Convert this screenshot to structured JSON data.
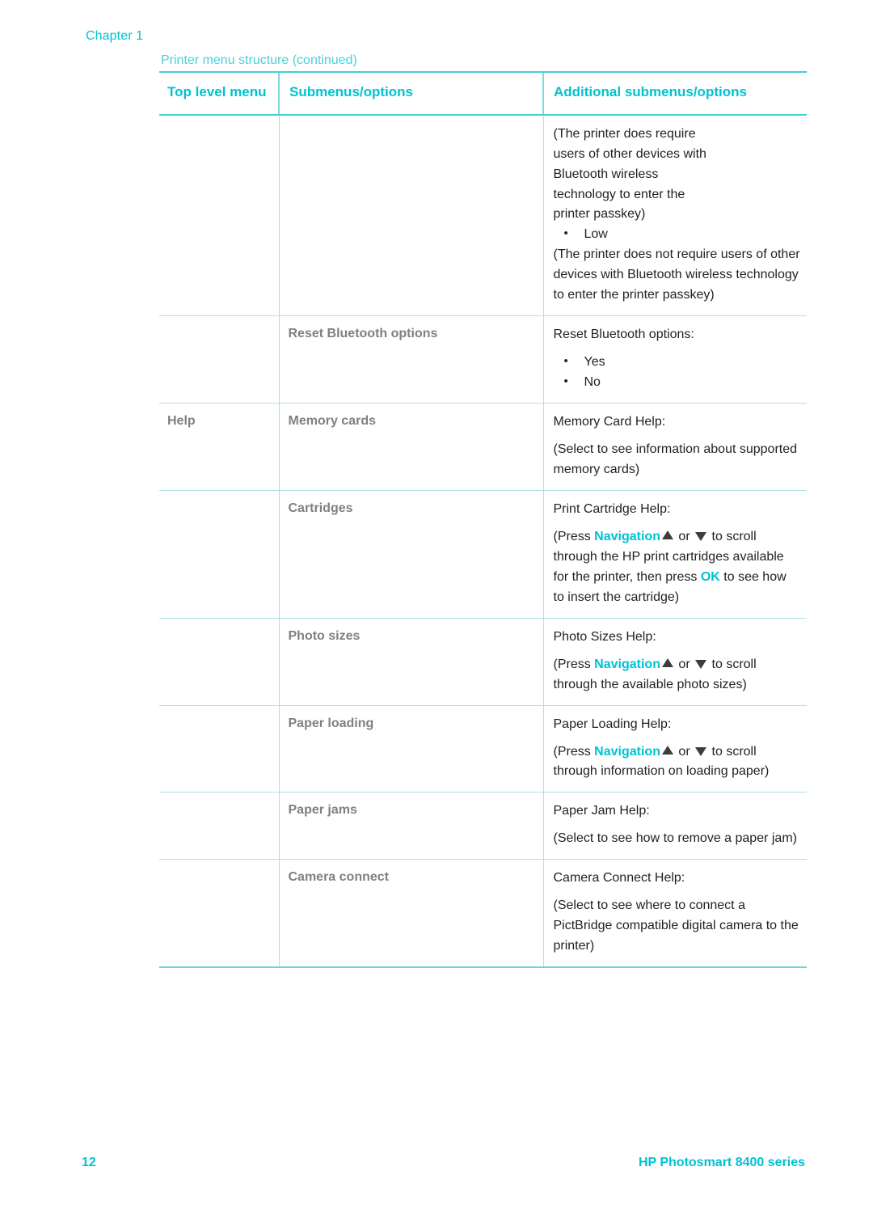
{
  "document": {
    "chapter_label": "Chapter 1",
    "table_caption": "Printer menu structure (continued)"
  },
  "colors": {
    "accent_cyan": "#00c2d1",
    "caption_cyan": "#4ecfd8",
    "label_gray": "#808080",
    "body_text": "#231f20",
    "rule_light": "#a9e2e8",
    "rule_strong": "#3fcfd8"
  },
  "table": {
    "headers": {
      "col1": "Top level menu",
      "col2": "Submenus/options",
      "col3": "Additional submenus/options"
    },
    "rows": [
      {
        "top_level": "",
        "submenu": "",
        "additional": {
          "continuation_lines": [
            "(The printer does require",
            "users of other devices with",
            "Bluetooth wireless",
            "technology to enter the",
            "printer passkey)"
          ],
          "bullets": [
            {
              "label": "Low",
              "note": "(The printer does not require users of other devices with Bluetooth wireless technology to enter the printer passkey)"
            }
          ]
        }
      },
      {
        "top_level": "",
        "submenu": "Reset Bluetooth options",
        "additional": {
          "heading": "Reset Bluetooth options:",
          "bullets": [
            {
              "label": "Yes"
            },
            {
              "label": "No"
            }
          ]
        }
      },
      {
        "top_level": "Help",
        "submenu": "Memory cards",
        "additional": {
          "heading": "Memory Card Help:",
          "note": "(Select to see information about supported memory cards)"
        }
      },
      {
        "top_level": "",
        "submenu": "Cartridges",
        "additional": {
          "heading": "Print Cartridge Help:",
          "note_parts": {
            "a": "(Press ",
            "highlight1": "Navigation",
            "icon_up": "triangle-up-icon",
            "b": " or ",
            "icon_down": "triangle-down-icon",
            "c": " to scroll through the HP print cartridges available for the printer, then press ",
            "highlight2": "OK",
            "d": " to see how to insert the cartridge)"
          }
        }
      },
      {
        "top_level": "",
        "submenu": "Photo sizes",
        "additional": {
          "heading": "Photo Sizes Help:",
          "note_parts": {
            "a": "(Press ",
            "highlight1": "Navigation",
            "b": " or ",
            "c": " to scroll through the available photo sizes)"
          }
        }
      },
      {
        "top_level": "",
        "submenu": "Paper loading",
        "additional": {
          "heading": "Paper Loading Help:",
          "note_parts": {
            "a": "(Press ",
            "highlight1": "Navigation",
            "b": " or ",
            "c": " to scroll through information on loading paper)"
          }
        }
      },
      {
        "top_level": "",
        "submenu": "Paper jams",
        "additional": {
          "heading": "Paper Jam Help:",
          "note": "(Select to see how to remove a paper jam)"
        }
      },
      {
        "top_level": "",
        "submenu": "Camera connect",
        "additional": {
          "heading": "Camera Connect Help:",
          "note": "(Select to see where to connect a PictBridge compatible digital camera to the printer)"
        }
      }
    ]
  },
  "footer": {
    "page_number": "12",
    "product": "HP Photosmart 8400 series"
  }
}
